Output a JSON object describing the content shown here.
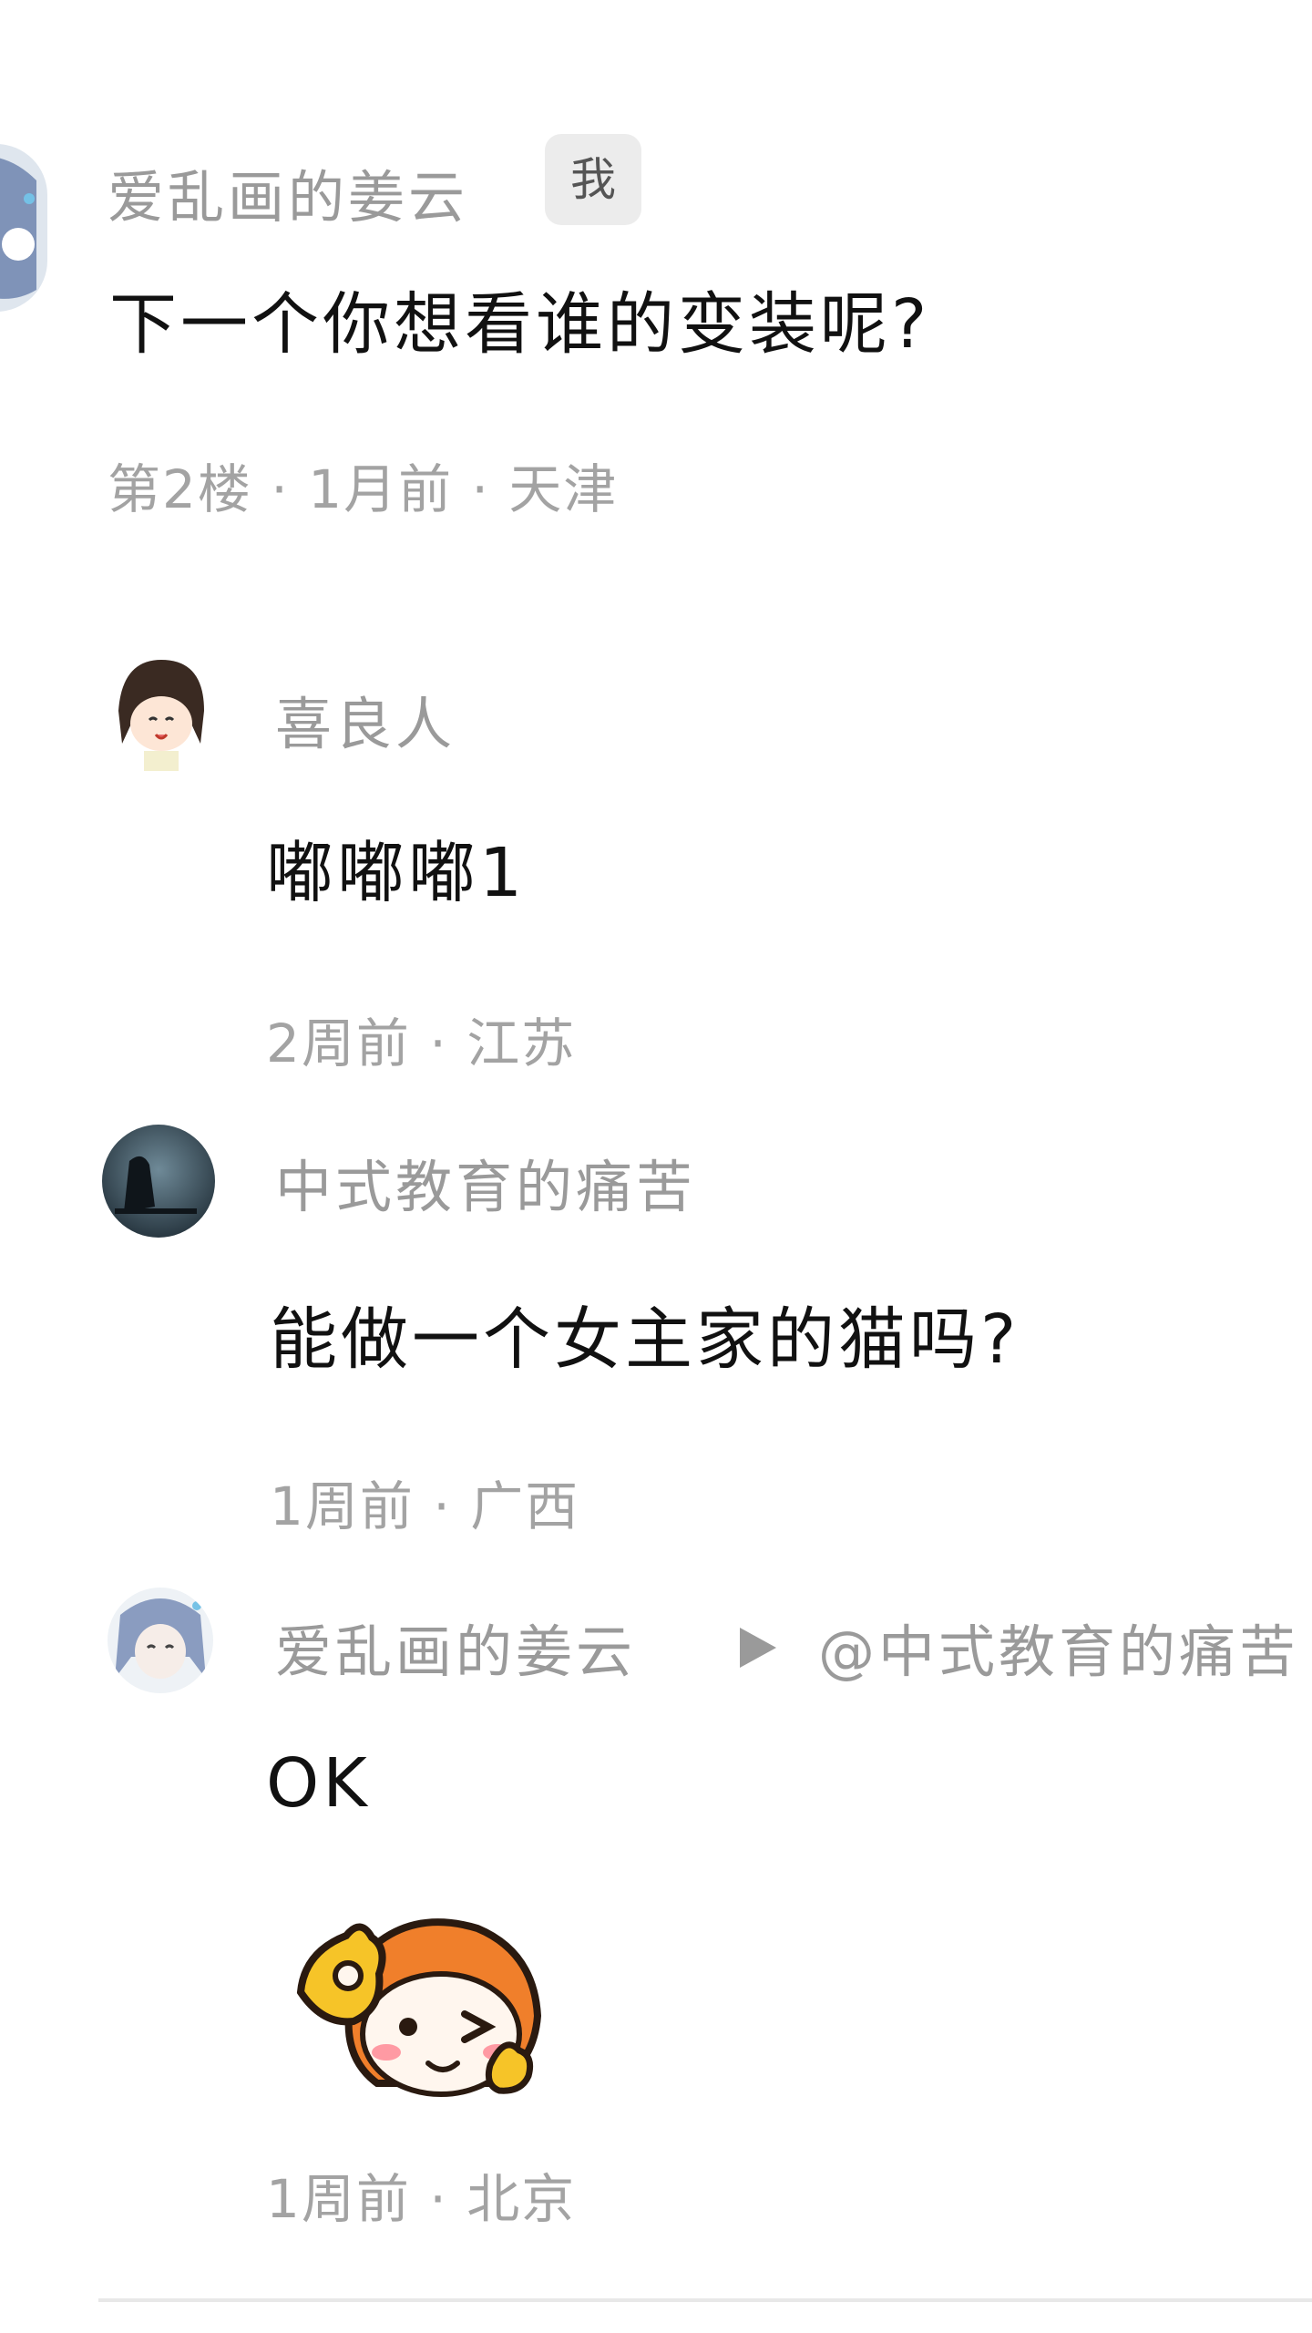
{
  "main_comment": {
    "author": "爱乱画的姜云",
    "badge": "我",
    "text": "下一个你想看谁的变装呢?",
    "meta": "第2楼 · 1月前 · 天津"
  },
  "replies": [
    {
      "author": "喜良人",
      "text": "嘟嘟嘟1",
      "meta": "2周前 · 江苏"
    },
    {
      "author": "中式教育的痛苦",
      "text": "能做一个女主家的猫吗?",
      "meta": "1周前 · 广西"
    },
    {
      "author": "爱乱画的姜云",
      "mention": "@中式教育的痛苦",
      "text": "OK",
      "meta": "1周前 · 北京"
    }
  ]
}
